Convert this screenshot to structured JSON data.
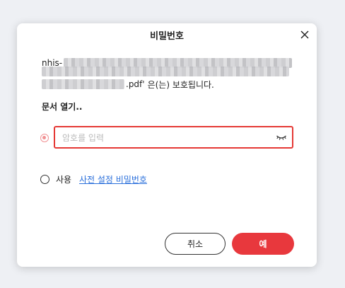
{
  "dialog": {
    "title": "비밀번호",
    "close_icon": "close-icon"
  },
  "file": {
    "name_prefix": "nhis-",
    "name_suffix": ".pdf'",
    "protected_text": "은(는) 보호됩니다."
  },
  "open_label": "문서 열기..",
  "password": {
    "value": "",
    "placeholder": "암호를 입력",
    "toggle_icon": "eye-closed-icon"
  },
  "preset": {
    "use_label": "사용",
    "link_label": "사전 설정 비밀번호"
  },
  "buttons": {
    "cancel_label": "취소",
    "ok_label": "예"
  },
  "colors": {
    "accent": "#e8383d",
    "input_border": "#e53935",
    "radio_selected": "#f19294",
    "link": "#2a6fdb",
    "backdrop": "#eef0f4"
  }
}
